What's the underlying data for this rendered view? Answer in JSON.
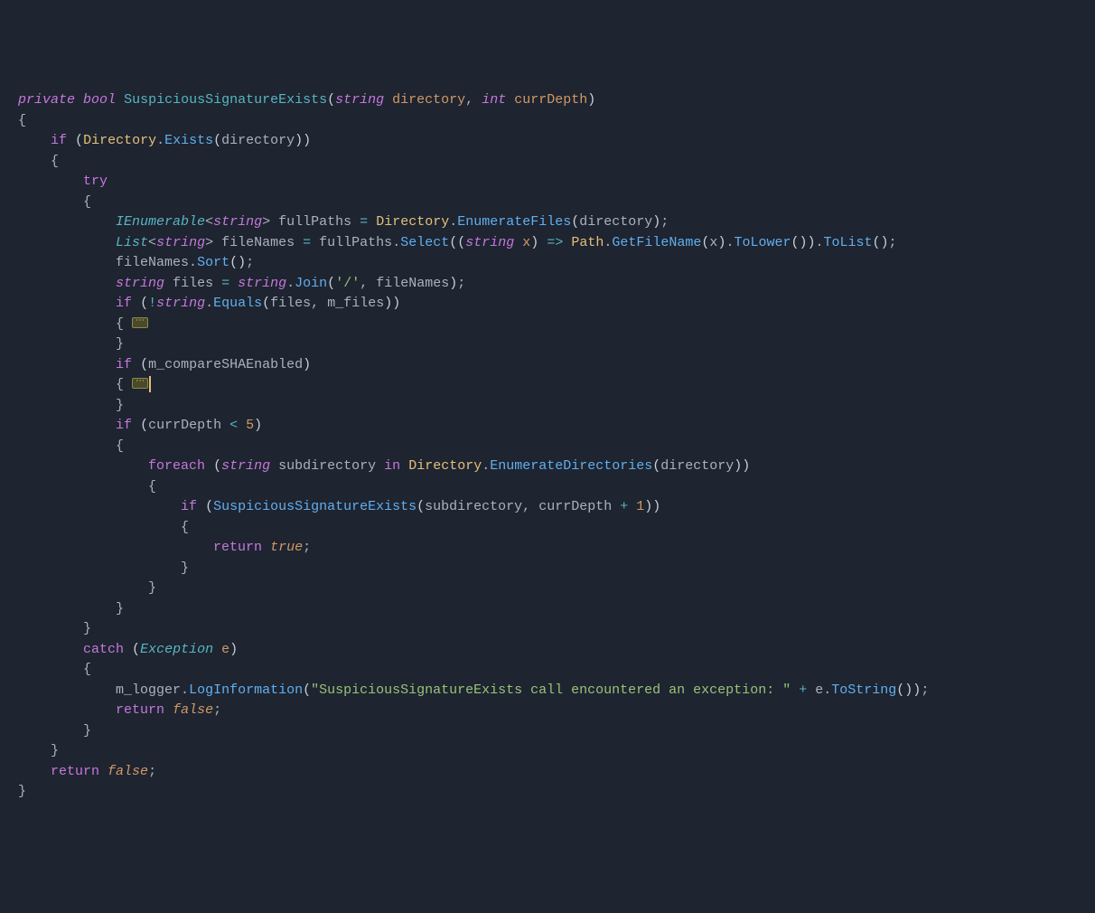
{
  "code": {
    "l1": {
      "access": "private",
      "rettype": "bool",
      "method": "SuspiciousSignatureExists",
      "ptype1": "string",
      "pname1": "directory",
      "ptype2": "int",
      "pname2": "currDepth"
    },
    "l3": {
      "kw": "if",
      "cls": "Directory",
      "call": "Exists",
      "arg": "directory"
    },
    "l5": {
      "kw": "try"
    },
    "l7": {
      "type": "IEnumerable",
      "gen": "string",
      "var": "fullPaths",
      "cls": "Directory",
      "call": "EnumerateFiles",
      "arg": "directory"
    },
    "l8": {
      "type": "List",
      "gen": "string",
      "var": "fileNames",
      "src": "fullPaths",
      "call1": "Select",
      "lamtype": "string",
      "lamvar": "x",
      "cls": "Path",
      "call2": "GetFileName",
      "call3": "ToLower",
      "call4": "ToList"
    },
    "l9": {
      "var": "fileNames",
      "call": "Sort"
    },
    "l10": {
      "type": "string",
      "var": "files",
      "cls": "string",
      "call": "Join",
      "arg1": "'/'",
      "arg2": "fileNames"
    },
    "l11": {
      "kw": "if",
      "cls": "string",
      "call": "Equals",
      "arg1": "files",
      "arg2": "m_files"
    },
    "l14": {
      "kw": "if",
      "var": "m_compareSHAEnabled"
    },
    "l17": {
      "kw": "if",
      "var": "currDepth",
      "op": "<",
      "num": "5"
    },
    "l19": {
      "kw": "foreach",
      "type": "string",
      "var": "subdirectory",
      "in": "in",
      "cls": "Directory",
      "call": "EnumerateDirectories",
      "arg": "directory"
    },
    "l21": {
      "kw": "if",
      "call": "SuspiciousSignatureExists",
      "arg1": "subdirectory",
      "arg2": "currDepth",
      "op": "+",
      "num": "1"
    },
    "l23": {
      "kw": "return",
      "val": "true"
    },
    "l28": {
      "kw": "catch",
      "type": "Exception",
      "var": "e"
    },
    "l30": {
      "var": "m_logger",
      "call": "LogInformation",
      "str": "\"SuspiciousSignatureExists call encountered an exception: \"",
      "op": "+",
      "evar": "e",
      "call2": "ToString"
    },
    "l31": {
      "kw": "return",
      "val": "false"
    },
    "l34": {
      "kw": "return",
      "val": "false"
    }
  }
}
